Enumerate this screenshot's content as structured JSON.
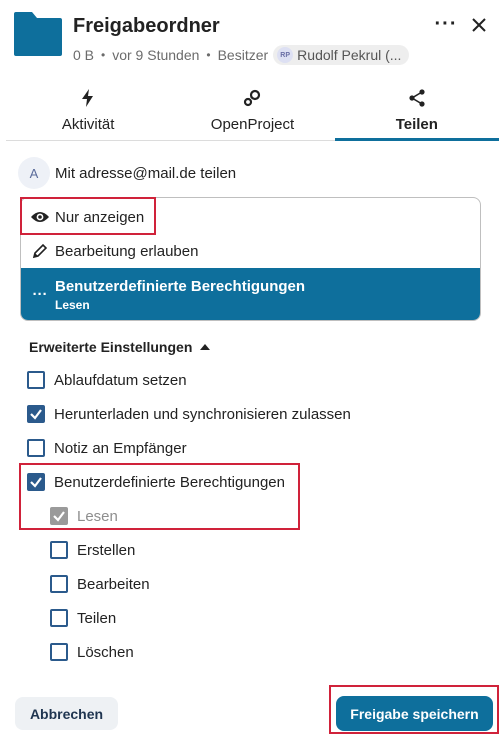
{
  "header": {
    "title": "Freigabeordner",
    "size": "0 B",
    "modified": "vor 9 Stunden",
    "owner_label": "Besitzer",
    "owner_initials": "RP",
    "owner_name": "Rudolf Pekrul (...",
    "folder_icon": "folder-icon",
    "accent_color": "#0e6f9c"
  },
  "tabs": [
    {
      "label": "Aktivität",
      "icon": "activity-icon",
      "active": false
    },
    {
      "label": "OpenProject",
      "icon": "openproject-icon",
      "active": false
    },
    {
      "label": "Teilen",
      "icon": "share-icon",
      "active": true
    }
  ],
  "share": {
    "avatar_initial": "A",
    "text": "Mit adresse@mail.de teilen"
  },
  "permissions": {
    "view": "Nur anzeigen",
    "edit": "Bearbeitung erlauben",
    "custom_title": "Benutzerdefinierte Berechtigungen",
    "custom_sub": "Lesen"
  },
  "advanced": {
    "toggle_label": "Erweiterte Einstellungen",
    "options": [
      {
        "label": "Ablaufdatum setzen",
        "checked": false
      },
      {
        "label": "Herunterladen und synchronisieren zulassen",
        "checked": true
      },
      {
        "label": "Notiz an Empfänger",
        "checked": false
      },
      {
        "label": "Benutzerdefinierte Berechtigungen",
        "checked": true
      }
    ],
    "custom_perms": [
      {
        "label": "Lesen",
        "checked": true,
        "disabled": true
      },
      {
        "label": "Erstellen",
        "checked": false
      },
      {
        "label": "Bearbeiten",
        "checked": false
      },
      {
        "label": "Teilen",
        "checked": false
      },
      {
        "label": "Löschen",
        "checked": false
      }
    ]
  },
  "footer": {
    "cancel": "Abbrechen",
    "save": "Freigabe speichern"
  }
}
